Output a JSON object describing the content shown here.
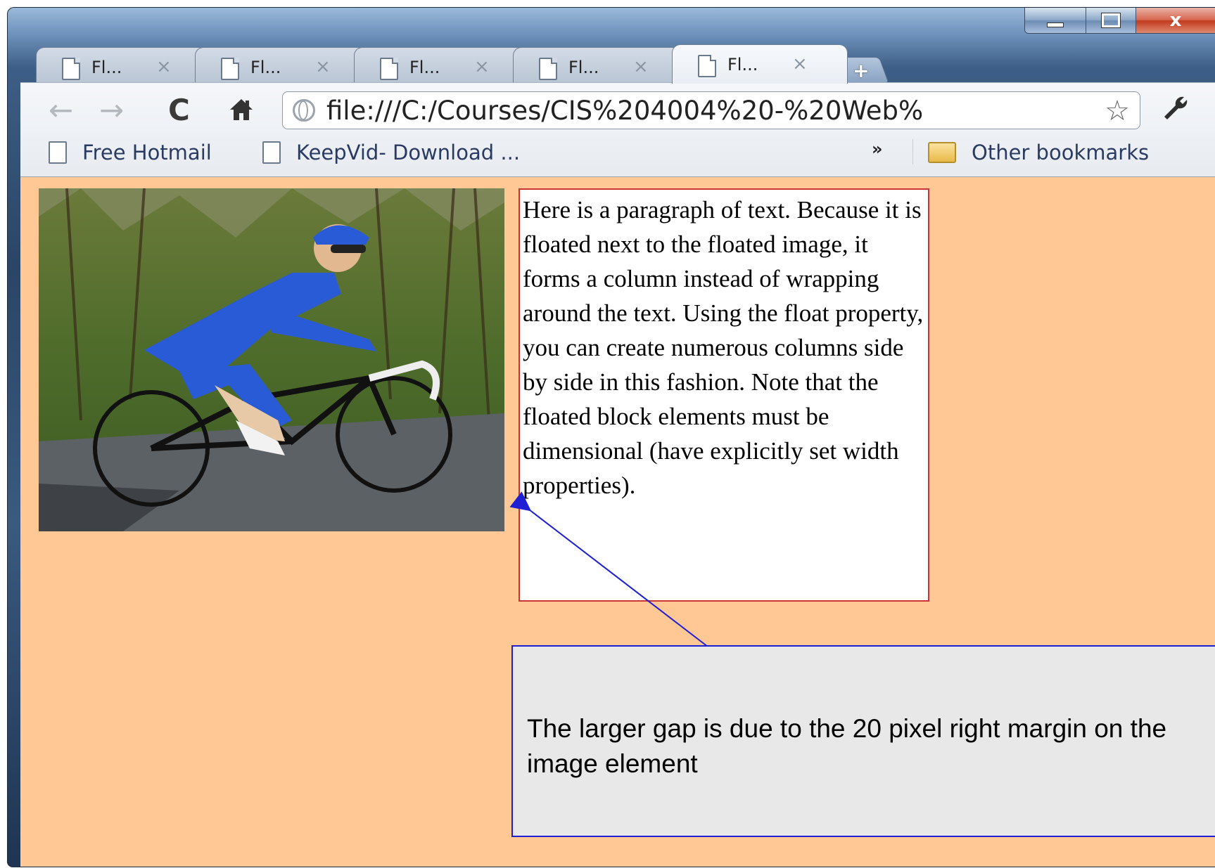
{
  "window": {
    "controls": {
      "minimize": "",
      "maximize": "",
      "close": "x"
    }
  },
  "tabs": [
    {
      "label": "Fl...",
      "close": "×",
      "active": false
    },
    {
      "label": "Fl...",
      "close": "×",
      "active": false
    },
    {
      "label": "Fl...",
      "close": "×",
      "active": false
    },
    {
      "label": "Fl...",
      "close": "×",
      "active": false
    },
    {
      "label": "Fl...",
      "close": "×",
      "active": true
    }
  ],
  "new_tab": "+",
  "toolbar": {
    "back": "←",
    "forward": "→",
    "reload": "C",
    "home": "🏠",
    "url": "file:///C:/Courses/CIS%204004%20-%20Web%",
    "star": "☆",
    "wrench": "🔧"
  },
  "bookmarks": {
    "items": [
      "Free Hotmail",
      "KeepVid- Download ..."
    ],
    "overflow": "»",
    "other": "Other bookmarks"
  },
  "page": {
    "paragraph": "Here is a paragraph of text. Because it is floated next to the floated image, it forms a column instead of wrapping around the text. Using the float property, you can create numerous columns side by side in this fashion. Note that the floated block elements must be dimensional (have explicitly set width properties).",
    "background_color": "#ffc895",
    "paragraph_border_color": "#cc3333"
  },
  "callout": {
    "text": "The larger gap is due to the 20 pixel right margin on the image element",
    "border_color": "#1f1fd6"
  },
  "colors": {
    "accent_blue": "#1f1fd6"
  }
}
